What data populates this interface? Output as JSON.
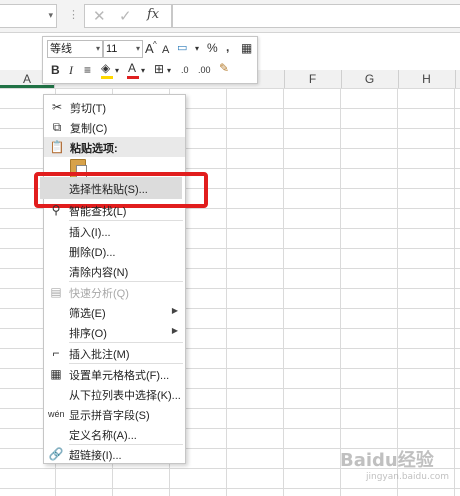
{
  "formula_bar": {
    "fx_label": "fx",
    "cancel_glyph": "✕",
    "enter_glyph": "✓",
    "separator": "⋮"
  },
  "columns": [
    "A",
    "F",
    "G",
    "H"
  ],
  "mini_toolbar": {
    "font_name": "等线",
    "font_size": "11",
    "increase_font": "A",
    "decrease_font": "A",
    "percent": "%",
    "comma": ",",
    "bold": "B",
    "italic": "I",
    "font_color": "A",
    "dec_more": ".0",
    "dec_less": ".00"
  },
  "context_menu": {
    "items": [
      {
        "label": "剪切(T)",
        "icon": "scissors-icon"
      },
      {
        "label": "复制(C)",
        "icon": "copy-icon"
      },
      {
        "label": "粘贴选项:",
        "icon": "paste-icon"
      },
      {
        "label": "选择性粘贴(S)...",
        "icon": ""
      },
      {
        "label": "智能查找(L)",
        "icon": "smart-lookup-icon"
      },
      {
        "label": "插入(I)...",
        "icon": ""
      },
      {
        "label": "删除(D)...",
        "icon": ""
      },
      {
        "label": "清除内容(N)",
        "icon": ""
      },
      {
        "label": "快速分析(Q)",
        "icon": "quick-analysis-icon"
      },
      {
        "label": "筛选(E)",
        "icon": ""
      },
      {
        "label": "排序(O)",
        "icon": ""
      },
      {
        "label": "插入批注(M)",
        "icon": "comment-icon"
      },
      {
        "label": "设置单元格格式(F)...",
        "icon": "format-cells-icon"
      },
      {
        "label": "从下拉列表中选择(K)...",
        "icon": ""
      },
      {
        "label": "显示拼音字段(S)",
        "icon": "phonetic-icon"
      },
      {
        "label": "定义名称(A)...",
        "icon": ""
      },
      {
        "label": "超链接(I)...",
        "icon": "hyperlink-icon"
      }
    ]
  },
  "watermark": {
    "text": "Baidu经验",
    "sub": "jingyan.baidu.com"
  }
}
